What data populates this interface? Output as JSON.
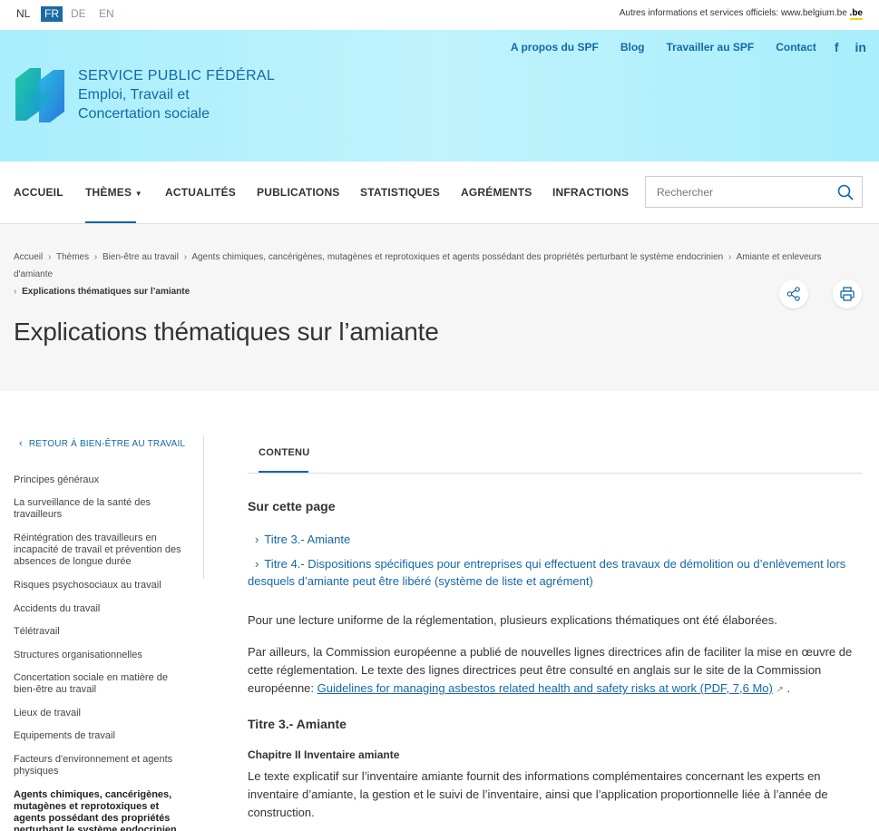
{
  "topbar": {
    "languages": [
      "NL",
      "FR",
      "DE",
      "EN"
    ],
    "official_text": "Autres informations et services officiels:",
    "official_link": "www.belgium.be",
    "be_logo": ".be"
  },
  "header": {
    "org_line1": "SERVICE PUBLIC FÉDÉRAL",
    "org_line2": "Emploi, Travail et",
    "org_line3": "Concertation sociale",
    "links": [
      "A propos du SPF",
      "Blog",
      "Travailler au SPF",
      "Contact"
    ],
    "social": [
      "f",
      "in"
    ],
    "logo_colors": [
      "#1fbf9b",
      "#1e7fd8"
    ]
  },
  "nav": {
    "items": [
      "ACCUEIL",
      "THÈMES",
      "ACTUALITÉS",
      "PUBLICATIONS",
      "STATISTIQUES",
      "AGRÉMENTS",
      "INFRACTIONS"
    ],
    "active": "THÈMES",
    "search_placeholder": "Rechercher"
  },
  "breadcrumb": {
    "items": [
      "Accueil",
      "Thèmes",
      "Bien-être au travail",
      "Agents chimiques, cancérigènes, mutagènes et reprotoxiques et agents possédant des propriétés perturbant le système endocrinien",
      "Amiante et enleveurs d'amiante"
    ],
    "current": "Explications thématiques sur l’amiante"
  },
  "page_title": "Explications thématiques sur l’amiante",
  "sidebar": {
    "back_label": "RETOUR À BIEN-ÊTRE AU TRAVAIL",
    "items": [
      "Principes généraux",
      "La surveillance de la santé des travailleurs",
      "Réintégration des travailleurs en incapacité de travail et prévention des absences de longue durée",
      "Risques psychosociaux au travail",
      "Accidents du travail",
      "Télétravail",
      "Structures organisationnelles",
      "Concertation sociale en matière de bien-être au travail",
      "Lieux de travail",
      "Equipements de travail",
      "Facteurs d'environnement et agents physiques",
      "Agents chimiques, cancérigènes, mutagènes et reprotoxiques et agents possédant des propriétés perturbant le système endocrinien"
    ]
  },
  "content": {
    "tab": "CONTENU",
    "on_page": "Sur cette page",
    "toc": [
      "Titre 3.- Amiante",
      "Titre 4.- Dispositions spécifiques pour entreprises qui effectuent des travaux de démolition ou d’enlèvement lors desquels d’amiante peut être libéré (système de liste et agrément)"
    ],
    "para1": "Pour une lecture uniforme de la réglementation, plusieurs explications thématiques ont été élaborées.",
    "para2_text": "Par ailleurs, la Commission européenne a publié de nouvelles lignes directrices afin de faciliter la mise en œuvre de cette réglementation. Le texte des lignes directrices peut être consulté en anglais sur le site de la Commission européenne:",
    "para2_link": "Guidelines for managing asbestos related health and safety risks at work (PDF, 7,6 Mo)",
    "para2_end": ".",
    "h_titre3": "Titre 3.- Amiante",
    "h_chapitre2": "Chapitre II Inventaire amiante",
    "para3": "Le texte explicatif sur l’inventaire amiante fournit des informations complémentaires concernant les experts en inventaire d’amiante, la gestion et le suivi de l’inventaire, ainsi que l’application proportionnelle liée à l’année de construction."
  }
}
